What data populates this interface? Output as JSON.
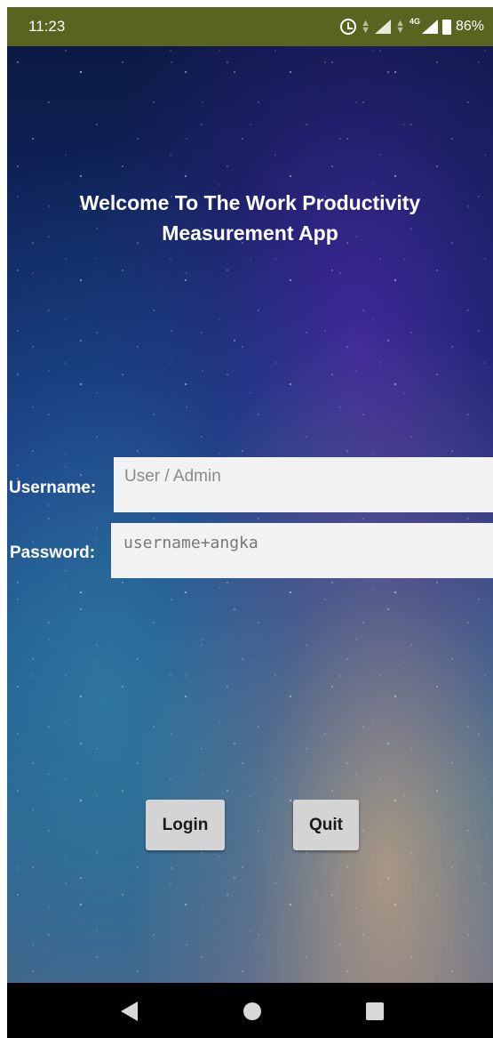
{
  "status_bar": {
    "time": "11:23",
    "network_type": "4G",
    "battery_percent": "86%",
    "icons": [
      "alarm-icon",
      "data-arrows-icon",
      "signal-icon",
      "battery-icon"
    ],
    "background_color": "#58641f"
  },
  "login_screen": {
    "title": "Welcome To The Work Productivity Measurement App",
    "username": {
      "label": "Username:",
      "placeholder": "User / Admin",
      "value": ""
    },
    "password": {
      "label": "Password:",
      "placeholder": "username+angka",
      "value": ""
    },
    "buttons": {
      "login_label": "Login",
      "quit_label": "Quit"
    }
  },
  "navigation_bar": {
    "icons": [
      "back-icon",
      "home-icon",
      "recents-icon"
    ]
  },
  "colors": {
    "input_background": "#f2f2f2",
    "button_background": "#d4d4d4",
    "title_text": "#ffffff"
  }
}
